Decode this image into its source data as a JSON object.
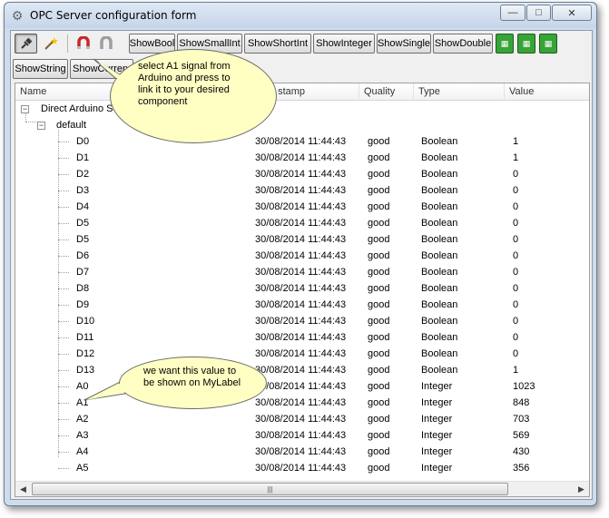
{
  "window": {
    "title": "OPC Server configuration form"
  },
  "titlebar_buttons": {
    "minimize": "—",
    "maximize": "□",
    "close": "✕"
  },
  "toolbar": {
    "buttons": [
      "ShowBool",
      "ShowSmallInt",
      "ShowShortInt",
      "ShowInteger",
      "ShowSingle",
      "ShowDouble"
    ],
    "row2": [
      "ShowString",
      "ShowCurrency"
    ]
  },
  "grid": {
    "columns": [
      "Name",
      "Time stamp",
      "Quality",
      "Type",
      "Value"
    ],
    "root": "Direct Arduino Server",
    "group": "default",
    "rows": [
      {
        "name": "D0",
        "time": "30/08/2014 11:44:43",
        "quality": "good",
        "type": "Boolean",
        "value": "1"
      },
      {
        "name": "D1",
        "time": "30/08/2014 11:44:43",
        "quality": "good",
        "type": "Boolean",
        "value": "1"
      },
      {
        "name": "D2",
        "time": "30/08/2014 11:44:43",
        "quality": "good",
        "type": "Boolean",
        "value": "0"
      },
      {
        "name": "D3",
        "time": "30/08/2014 11:44:43",
        "quality": "good",
        "type": "Boolean",
        "value": "0"
      },
      {
        "name": "D4",
        "time": "30/08/2014 11:44:43",
        "quality": "good",
        "type": "Boolean",
        "value": "0"
      },
      {
        "name": "D5",
        "time": "30/08/2014 11:44:43",
        "quality": "good",
        "type": "Boolean",
        "value": "0"
      },
      {
        "name": "D5",
        "time": "30/08/2014 11:44:43",
        "quality": "good",
        "type": "Boolean",
        "value": "0"
      },
      {
        "name": "D6",
        "time": "30/08/2014 11:44:43",
        "quality": "good",
        "type": "Boolean",
        "value": "0"
      },
      {
        "name": "D7",
        "time": "30/08/2014 11:44:43",
        "quality": "good",
        "type": "Boolean",
        "value": "0"
      },
      {
        "name": "D8",
        "time": "30/08/2014 11:44:43",
        "quality": "good",
        "type": "Boolean",
        "value": "0"
      },
      {
        "name": "D9",
        "time": "30/08/2014 11:44:43",
        "quality": "good",
        "type": "Boolean",
        "value": "0"
      },
      {
        "name": "D10",
        "time": "30/08/2014 11:44:43",
        "quality": "good",
        "type": "Boolean",
        "value": "0"
      },
      {
        "name": "D11",
        "time": "30/08/2014 11:44:43",
        "quality": "good",
        "type": "Boolean",
        "value": "0"
      },
      {
        "name": "D12",
        "time": "30/08/2014 11:44:43",
        "quality": "good",
        "type": "Boolean",
        "value": "0"
      },
      {
        "name": "D13",
        "time": "30/08/2014 11:44:43",
        "quality": "good",
        "type": "Boolean",
        "value": "1"
      },
      {
        "name": "A0",
        "time": "30/08/2014 11:44:43",
        "quality": "good",
        "type": "Integer",
        "value": "1023"
      },
      {
        "name": "A1",
        "time": "30/08/2014 11:44:43",
        "quality": "good",
        "type": "Integer",
        "value": "848"
      },
      {
        "name": "A2",
        "time": "30/08/2014 11:44:43",
        "quality": "good",
        "type": "Integer",
        "value": "703"
      },
      {
        "name": "A3",
        "time": "30/08/2014 11:44:43",
        "quality": "good",
        "type": "Integer",
        "value": "569"
      },
      {
        "name": "A4",
        "time": "30/08/2014 11:44:43",
        "quality": "good",
        "type": "Integer",
        "value": "430"
      },
      {
        "name": "A5",
        "time": "30/08/2014 11:44:43",
        "quality": "good",
        "type": "Integer",
        "value": "356"
      }
    ]
  },
  "callouts": {
    "top": [
      "select A1 signal from",
      "Arduino and press to",
      "link it to your desired",
      "component"
    ],
    "bottom": [
      "we want this value to",
      "be shown on MyLabel"
    ]
  },
  "scrollbar": {
    "left_arrow": "◀",
    "right_arrow": "▶",
    "grip": "|||"
  },
  "icons": [
    "gear-icon",
    "plug-icon",
    "magic-wand-icon",
    "magnet-link-icon",
    "magnet-unlink-icon",
    "chip-icon"
  ]
}
